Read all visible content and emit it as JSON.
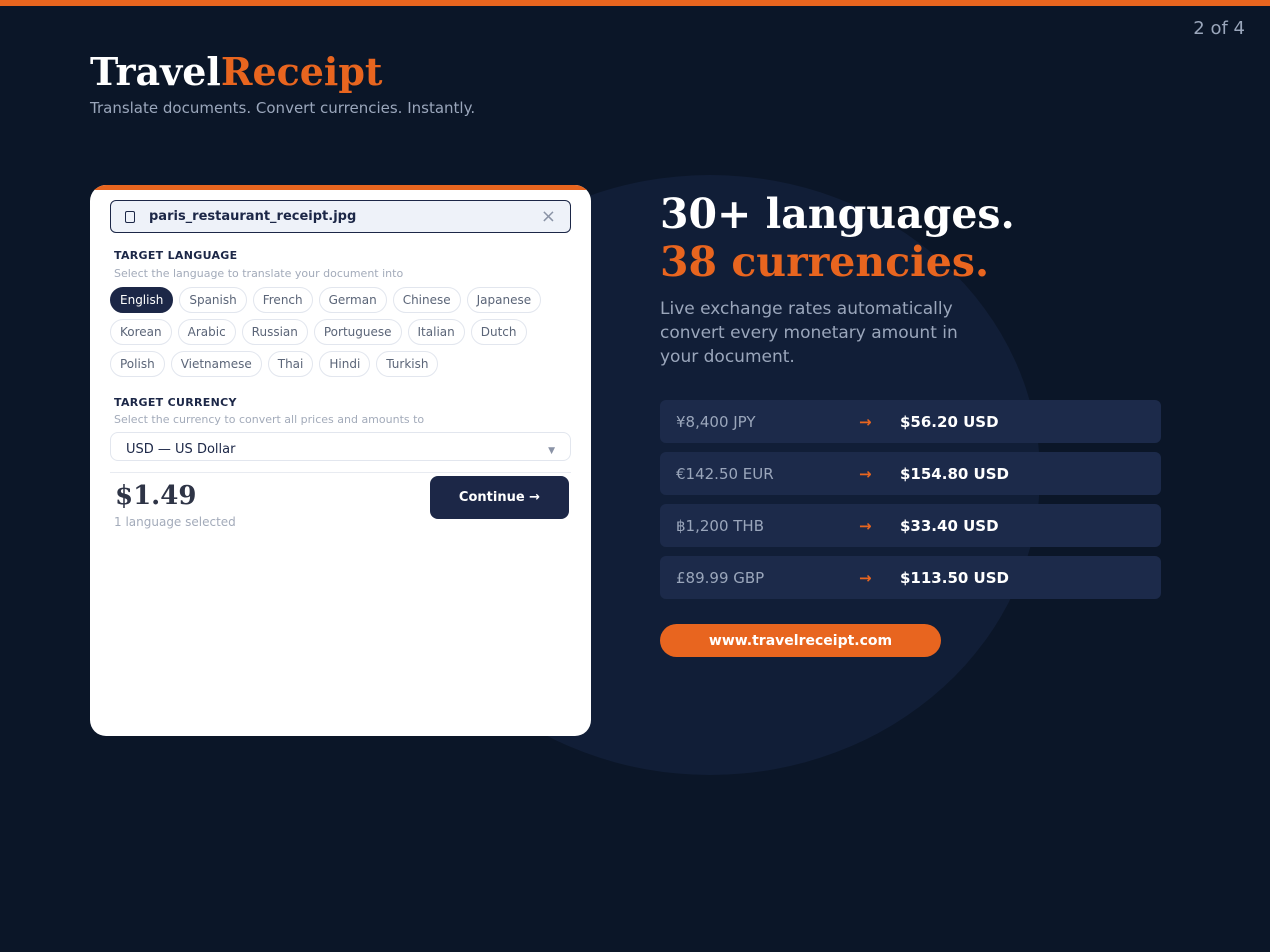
{
  "page_indicator": "2 of 4",
  "brand": {
    "logo_part1": "Travel",
    "logo_part2": "Receipt",
    "tagline": "Translate documents. Convert currencies. Instantly."
  },
  "card": {
    "file_name": "paris_restaurant_receipt.jpg",
    "close_icon": "×",
    "language_section": {
      "title": "TARGET LANGUAGE",
      "subtitle": "Select the language to translate your document into",
      "rows": [
        [
          "English",
          "Spanish",
          "French",
          "German",
          "Chinese",
          "Japanese"
        ],
        [
          "Korean",
          "Arabic",
          "Russian",
          "Portuguese",
          "Italian",
          "Dutch"
        ],
        [
          "Polish",
          "Vietnamese",
          "Thai",
          "Hindi",
          "Turkish"
        ]
      ],
      "selected": "English"
    },
    "currency_section": {
      "title": "TARGET CURRENCY",
      "subtitle": "Select the currency to convert all prices and amounts to",
      "selected_value": "USD — US Dollar",
      "arrow": "▼"
    },
    "price": "$1.49",
    "price_sub": "1 language selected",
    "continue_label": "Continue →"
  },
  "hero": {
    "line1": "30+ languages.",
    "line2": "38 currencies.",
    "description": "Live exchange rates automatically convert every monetary amount in your document."
  },
  "rates": [
    {
      "from": "¥8,400 JPY",
      "arrow": "→",
      "to": "$56.20 USD"
    },
    {
      "from": "€142.50 EUR",
      "arrow": "→",
      "to": "$154.80 USD"
    },
    {
      "from": "฿1,200 THB",
      "arrow": "→",
      "to": "$33.40 USD"
    },
    {
      "from": "£89.99 GBP",
      "arrow": "→",
      "to": "$113.50 USD"
    }
  ],
  "url": "www.travelreceipt.com",
  "colors": {
    "background": "#0b1628",
    "accent": "#e8651f",
    "navy": "#1c2747",
    "rate_row": "#1c2a4a"
  },
  "icons": {
    "file": "file-icon",
    "close": "close-icon",
    "dropdown": "chevron-down-icon"
  }
}
